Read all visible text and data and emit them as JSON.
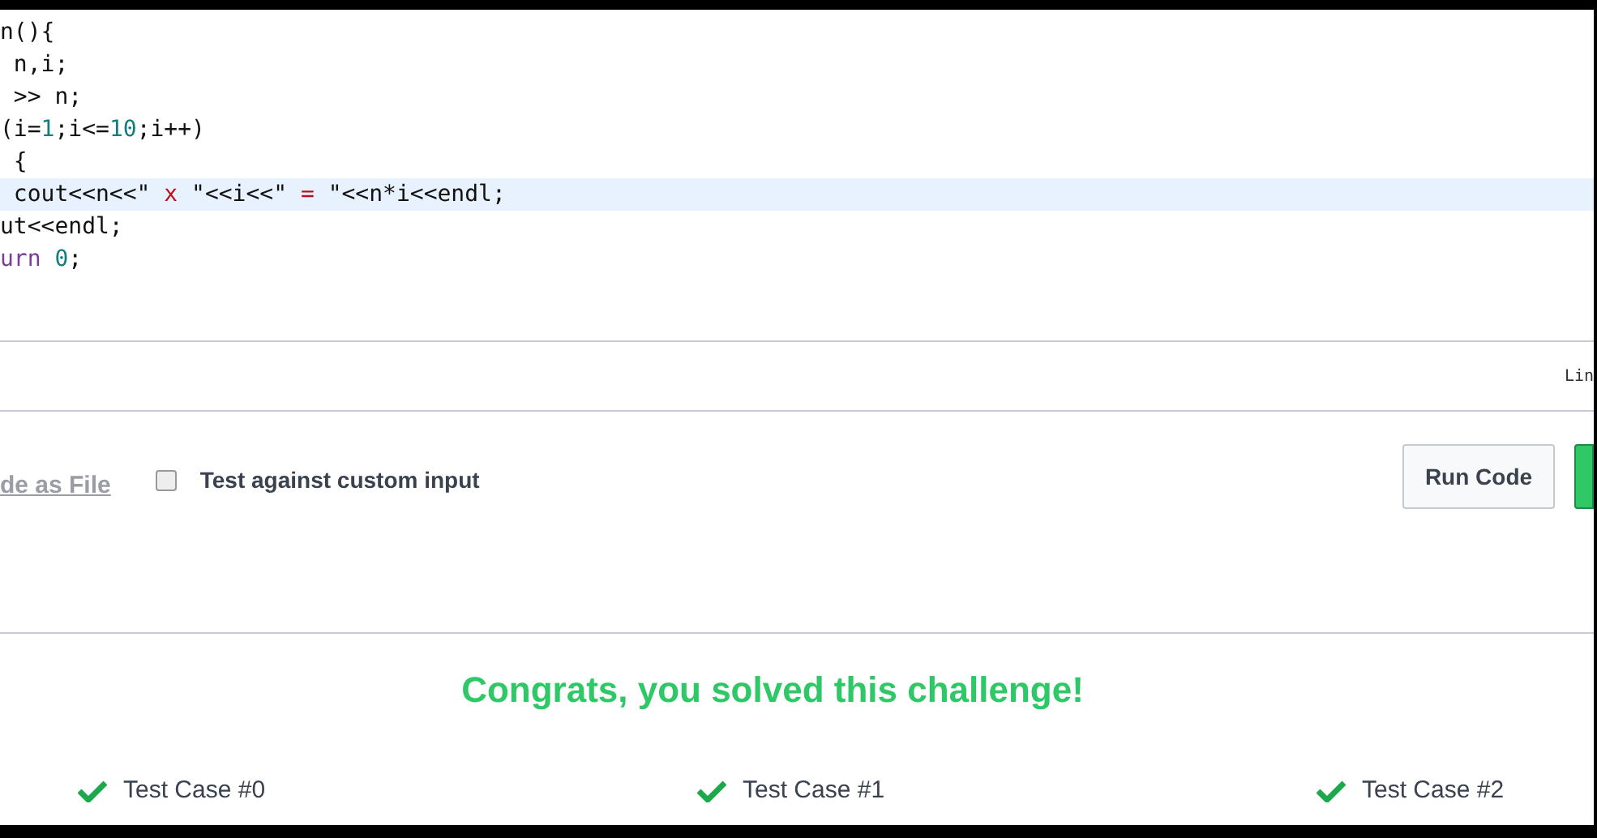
{
  "editor": {
    "lines": [
      {
        "active": false,
        "segments": [
          {
            "kind": "plain",
            "text": "n(){"
          }
        ]
      },
      {
        "active": false,
        "segments": [
          {
            "kind": "plain",
            "text": " n,i;"
          }
        ]
      },
      {
        "active": false,
        "segments": [
          {
            "kind": "plain",
            "text": " >> n;"
          }
        ]
      },
      {
        "active": false,
        "segments": [
          {
            "kind": "plain",
            "text": "(i="
          },
          {
            "kind": "number",
            "text": "1"
          },
          {
            "kind": "plain",
            "text": ";i<="
          },
          {
            "kind": "number",
            "text": "10"
          },
          {
            "kind": "plain",
            "text": ";i++)"
          }
        ]
      },
      {
        "active": false,
        "segments": [
          {
            "kind": "plain",
            "text": " {"
          }
        ]
      },
      {
        "active": true,
        "segments": [
          {
            "kind": "plain",
            "text": " cout<<n<<\" "
          },
          {
            "kind": "string",
            "text": "x"
          },
          {
            "kind": "plain",
            "text": " \"<<i<<\" "
          },
          {
            "kind": "string",
            "text": "="
          },
          {
            "kind": "plain",
            "text": " \"<<n*i<<endl;"
          }
        ]
      },
      {
        "active": false,
        "segments": [
          {
            "kind": "plain",
            "text": "ut<<endl;"
          }
        ]
      },
      {
        "active": false,
        "segments": [
          {
            "kind": "keyword",
            "text": "urn"
          },
          {
            "kind": "number",
            "text": " 0"
          },
          {
            "kind": "plain",
            "text": ";"
          }
        ]
      }
    ],
    "status": "Lin"
  },
  "actions": {
    "upload_link": "de as File",
    "custom_input": {
      "label": "Test against custom input",
      "checked": false
    },
    "run_button": "Run Code"
  },
  "result": {
    "message": "Congrats, you solved this challenge!",
    "test_cases": [
      {
        "label": "Test Case #0",
        "passed": true
      },
      {
        "label": "Test Case #1",
        "passed": true
      },
      {
        "label": "Test Case #2",
        "passed": true
      }
    ]
  }
}
